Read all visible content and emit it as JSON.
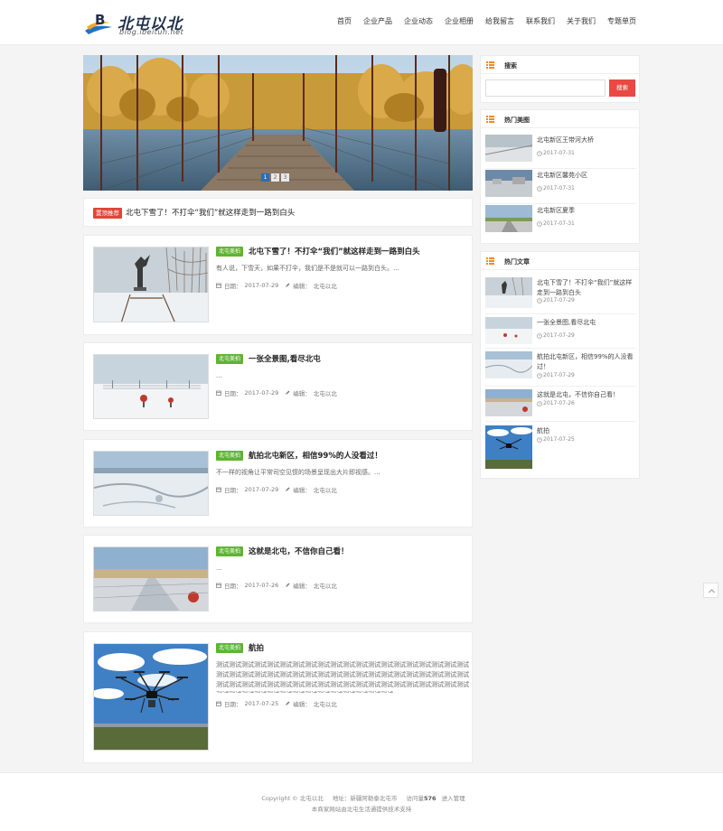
{
  "site": {
    "logo_cn": "北屯以北",
    "logo_en": "blog.ibeitun.net"
  },
  "nav": [
    {
      "label": "首页"
    },
    {
      "label": "企业产品"
    },
    {
      "label": "企业动态"
    },
    {
      "label": "企业相册"
    },
    {
      "label": "给我留言"
    },
    {
      "label": "联系我们"
    },
    {
      "label": "关于我们"
    },
    {
      "label": "专题单页"
    }
  ],
  "slider": {
    "dots": [
      "1",
      "2",
      "3"
    ],
    "active_index": 0
  },
  "notice": {
    "tag": "置顶推荐",
    "title": "北屯下雪了！不打伞“我们”就这样走到一路到白头"
  },
  "meta_labels": {
    "date": "日期：",
    "editor": "编辑："
  },
  "articles": [
    {
      "category": "北屯美拍",
      "title": "北屯下雪了！不打伞“我们”就这样走到一路到白头",
      "excerpt": "有人说，下雪天，如果不打伞，我们是不是就可以一路到白头。...",
      "date": "2017-07-29",
      "author": "北屯以北"
    },
    {
      "category": "北屯美拍",
      "title": "一张全景图,看尽北屯",
      "excerpt": "...",
      "date": "2017-07-29",
      "author": "北屯以北"
    },
    {
      "category": "北屯美拍",
      "title": "航拍北屯新区，相信99%的人没看过！",
      "excerpt": "不一样的视角让平常司空见惯的场景呈现出大片即视感。...",
      "date": "2017-07-29",
      "author": "北屯以北"
    },
    {
      "category": "北屯美拍",
      "title": "这就是北屯，不信你自己看！",
      "excerpt": "...",
      "date": "2017-07-26",
      "author": "北屯以北"
    },
    {
      "category": "北屯美拍",
      "title": "航拍",
      "excerpt": "测试测试测试测试测试测试测试测试测试测试测试测试测试测试测试测试测试测试测试测试测试测试测试测试测试测试测试测试测试测试测试测试测试测试测试测试测试测试测试测试测试测试测试测试测试测试测试测试测试测试测试测试测试测试测试测试测试测试测试测试测试测试测试测试测试测试测试测试测试测试测试测试测试测试...",
      "date": "2017-07-25",
      "author": "北屯以北"
    }
  ],
  "sidebar": {
    "search": {
      "title": "搜索",
      "placeholder": "",
      "button": "搜索"
    },
    "hot_images": {
      "title": "热门美图",
      "items": [
        {
          "title": "北屯新区王带河大桥",
          "date": "2017-07-31"
        },
        {
          "title": "北屯新区馨苑小区",
          "date": "2017-07-31"
        },
        {
          "title": "北屯新区夏季",
          "date": "2017-07-31"
        }
      ]
    },
    "hot_articles": {
      "title": "热门文章",
      "items": [
        {
          "title": "北屯下雪了！不打伞“我们”就这样走到一路到白头",
          "date": "2017-07-29"
        },
        {
          "title": "一张全景图,看尽北屯",
          "date": "2017-07-29"
        },
        {
          "title": "航拍北屯新区，相信99%的人没看过！",
          "date": "2017-07-29"
        },
        {
          "title": "这就是北屯，不信你自己看！",
          "date": "2017-07-26"
        },
        {
          "title": "航拍",
          "date": "2017-07-25"
        }
      ]
    }
  },
  "footer": {
    "copyright": "Copyright © 北屯以北",
    "address": "地址：新疆阿勒泰北屯市",
    "visits_label": "访问量",
    "visits": "576",
    "admin": "进入管理",
    "support": "本商家网站由北屯生活通提供技术支持"
  },
  "colors": {
    "accent_red": "#e84a43",
    "category_green": "#5fb433",
    "widget_icon_orange": "#f08a24",
    "slider_active": "#2a6db5"
  },
  "icons": {
    "widget": "list-icon",
    "date": "calendar-icon",
    "editor": "pencil-icon",
    "side_date": "clock-icon",
    "backtop": "chevron-up-icon"
  }
}
